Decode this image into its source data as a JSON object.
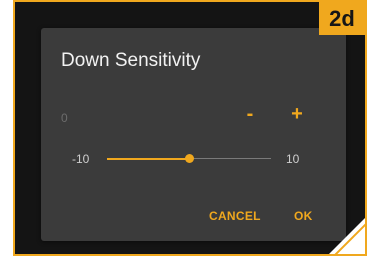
{
  "step_badge": "2d",
  "dialog": {
    "title": "Down Sensitivity",
    "current_value": "0",
    "minus_label": "-",
    "plus_label": "+",
    "slider": {
      "min_label": "-10",
      "max_label": "10",
      "min": -10,
      "max": 10,
      "value": 0
    },
    "cancel_label": "CANCEL",
    "ok_label": "OK"
  },
  "colors": {
    "accent": "#f0a81e",
    "dialog_background": "#3b3b3b",
    "frame_background": "#141414"
  }
}
